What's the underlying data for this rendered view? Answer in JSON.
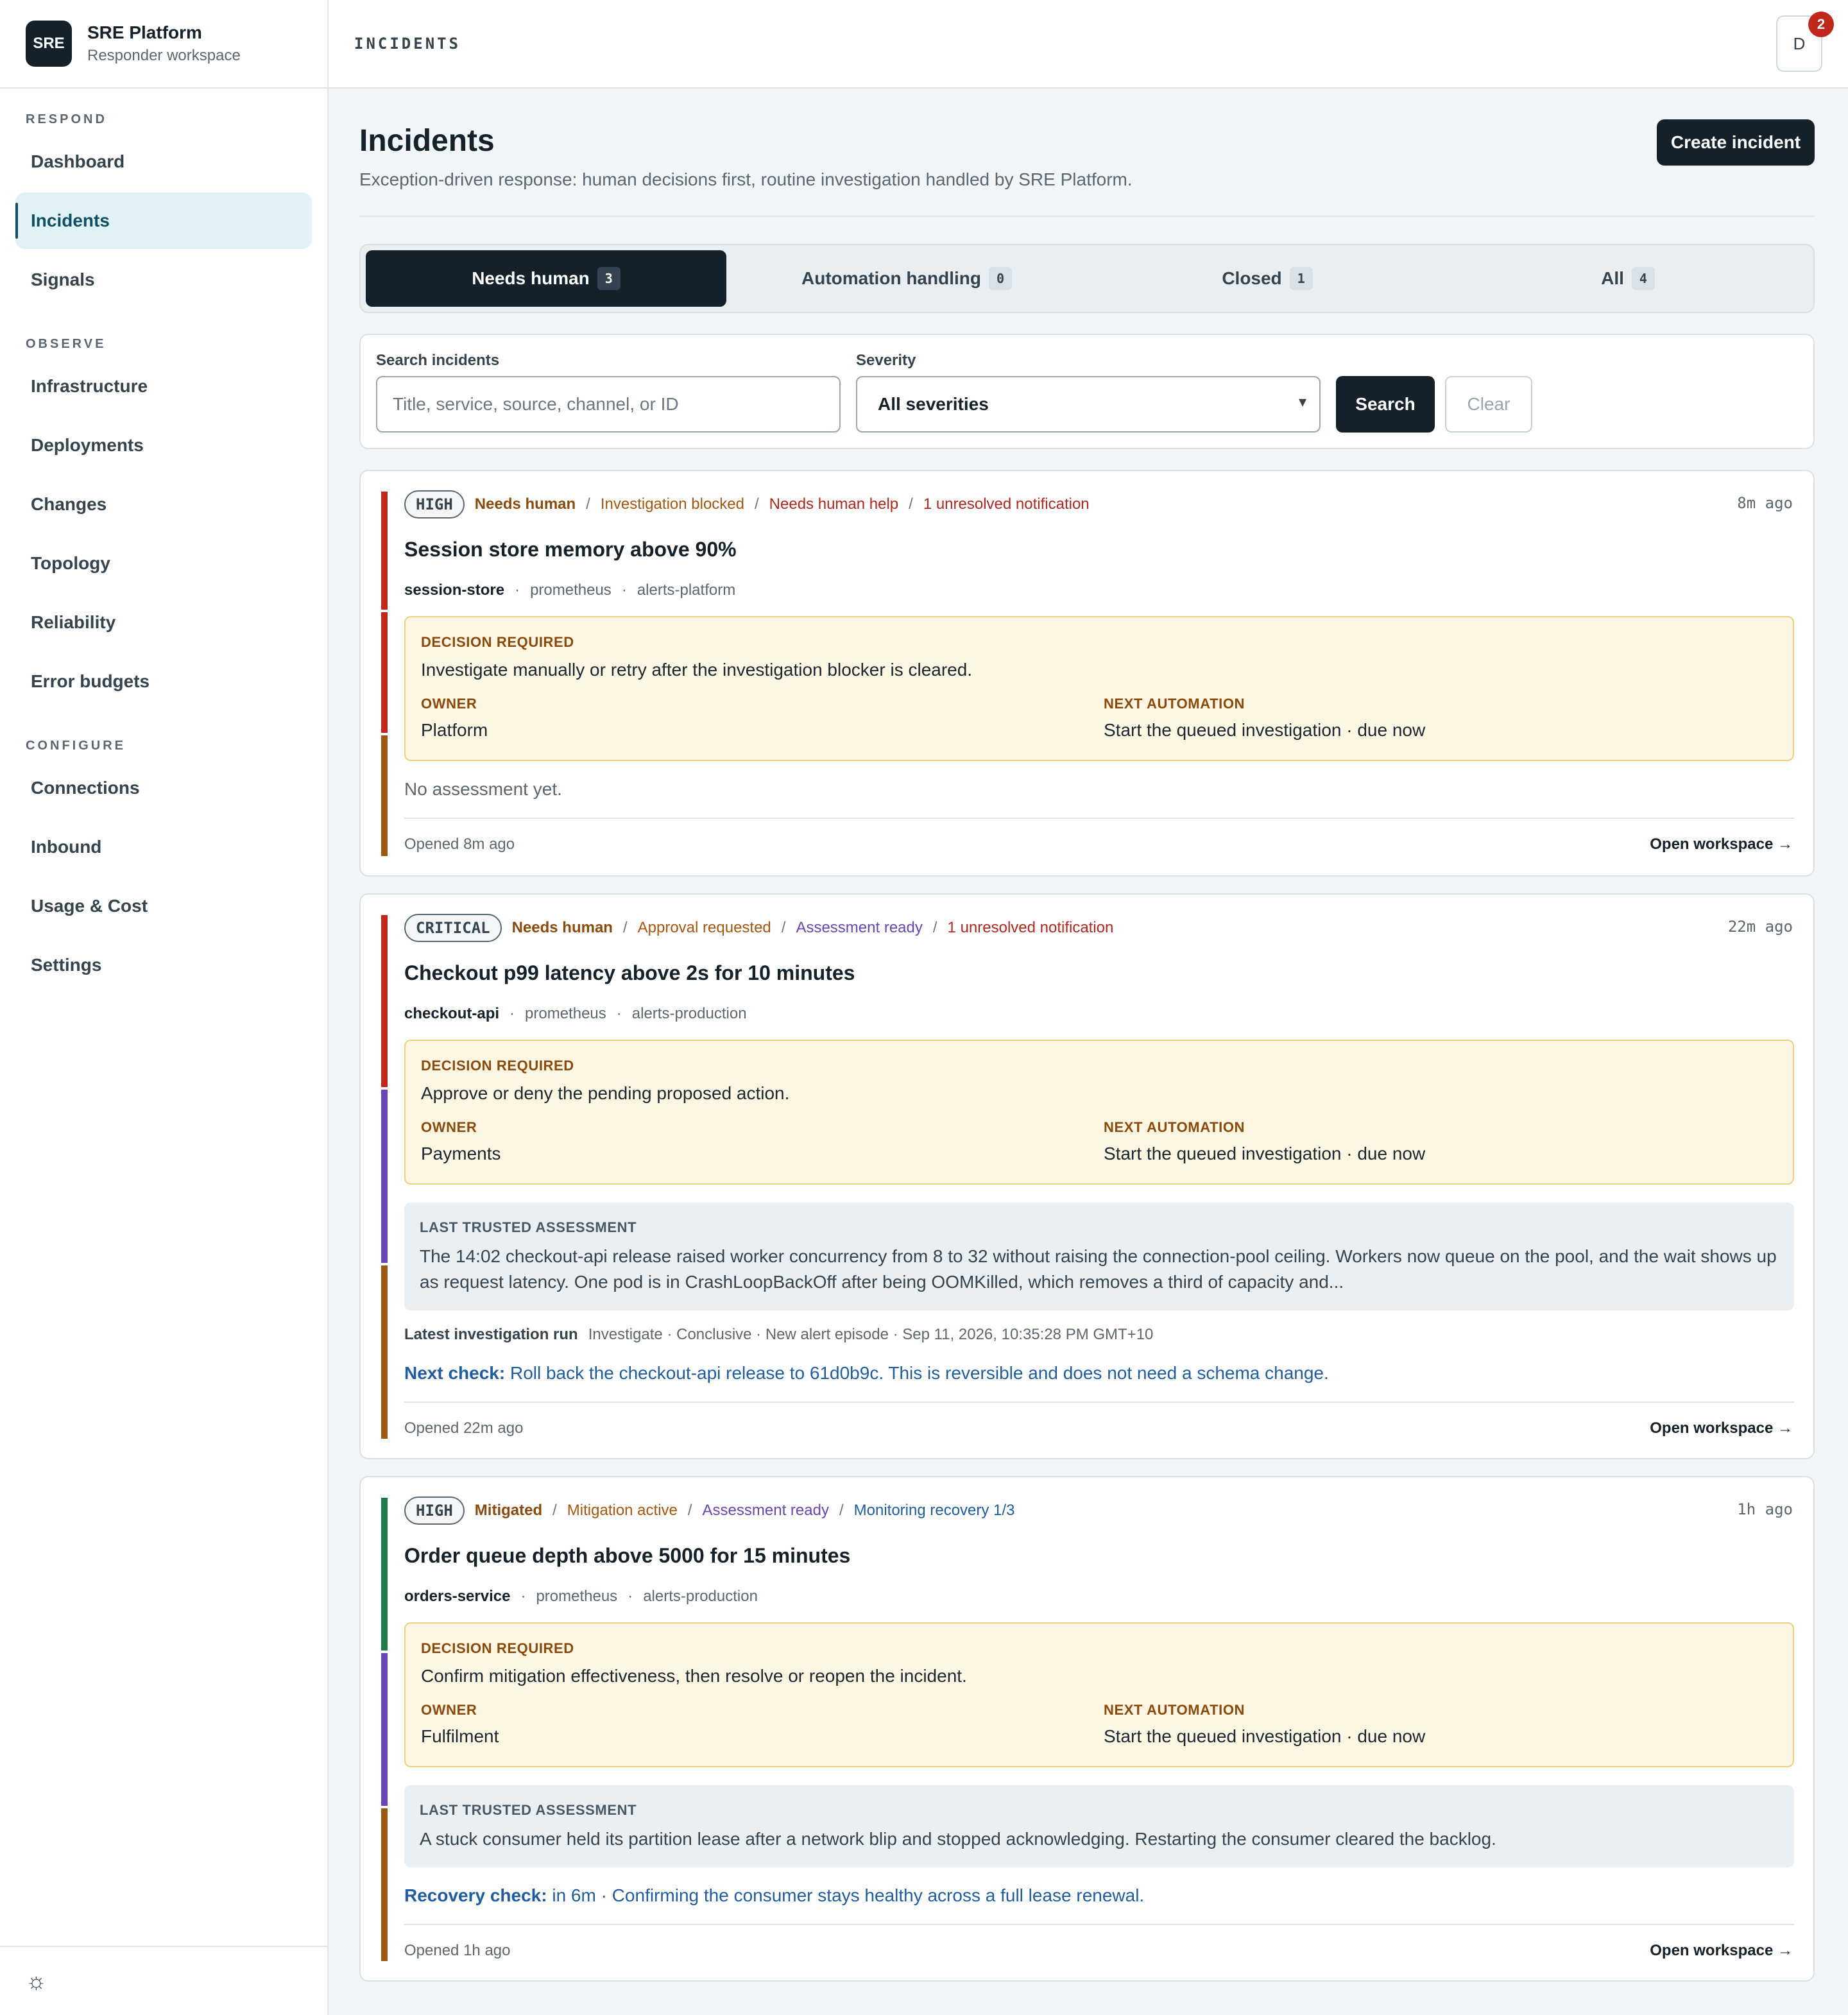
{
  "brand": {
    "logo": "SRE",
    "title": "SRE Platform",
    "subtitle": "Responder workspace"
  },
  "sidebar": {
    "sections": [
      {
        "label": "RESPOND",
        "items": [
          "Dashboard",
          "Incidents",
          "Signals"
        ]
      },
      {
        "label": "OBSERVE",
        "items": [
          "Infrastructure",
          "Deployments",
          "Changes",
          "Topology",
          "Reliability",
          "Error budgets"
        ]
      },
      {
        "label": "CONFIGURE",
        "items": [
          "Connections",
          "Inbound",
          "Usage & Cost",
          "Settings"
        ]
      }
    ],
    "active_item": "Incidents",
    "theme_icon": "sun-icon"
  },
  "topbar": {
    "title": "INCIDENTS",
    "avatar_initial": "D",
    "notification_count": "2"
  },
  "page": {
    "title": "Incidents",
    "subtitle": "Exception-driven response: human decisions first, routine investigation handled by SRE Platform.",
    "create_label": "Create incident"
  },
  "tabs": [
    {
      "label": "Needs human",
      "count": "3",
      "active": true
    },
    {
      "label": "Automation handling",
      "count": "0",
      "active": false
    },
    {
      "label": "Closed",
      "count": "1",
      "active": false
    },
    {
      "label": "All",
      "count": "4",
      "active": false
    }
  ],
  "filters": {
    "search_label": "Search incidents",
    "search_placeholder": "Title, service, source, channel, ID",
    "search_placeholder_full": "Title, service, source, channel, or ID",
    "search_value": "",
    "severity_label": "Severity",
    "severity_value": "All severities",
    "search_button": "Search",
    "clear_button": "Clear"
  },
  "incidents": [
    {
      "severity": "HIGH",
      "state": "Needs human",
      "tags": [
        {
          "text": "Investigation blocked",
          "tone": "orange"
        },
        {
          "text": "Needs human help",
          "tone": "red"
        },
        {
          "text": "1 unresolved notification",
          "tone": "red"
        }
      ],
      "age": "8m ago",
      "title": "Session store memory above 90%",
      "service": "session-store",
      "source": "prometheus",
      "channel": "alerts-platform",
      "decision_label": "DECISION REQUIRED",
      "decision": "Investigate manually or retry after the investigation blocker is cleared.",
      "owner_label": "OWNER",
      "owner": "Platform",
      "next_label": "NEXT AUTOMATION",
      "next_automation": "Start the queued investigation · due now",
      "no_assessment": "No assessment yet.",
      "opened": "Opened 8m ago",
      "workspace_link": "Open workspace →"
    },
    {
      "severity": "CRITICAL",
      "state": "Needs human",
      "tags": [
        {
          "text": "Approval requested",
          "tone": "orange"
        },
        {
          "text": "Assessment ready",
          "tone": "purple"
        },
        {
          "text": "1 unresolved notification",
          "tone": "red"
        }
      ],
      "age": "22m ago",
      "title": "Checkout p99 latency above 2s for 10 minutes",
      "service": "checkout-api",
      "source": "prometheus",
      "channel": "alerts-production",
      "decision_label": "DECISION REQUIRED",
      "decision": "Approve or deny the pending proposed action.",
      "owner_label": "OWNER",
      "owner": "Payments",
      "next_label": "NEXT AUTOMATION",
      "next_automation": "Start the queued investigation · due now",
      "assessment_label": "LAST TRUSTED ASSESSMENT",
      "assessment": "The 14:02 checkout-api release raised worker concurrency from 8 to 32 without raising the connection-pool ceiling. Workers now queue on the pool, and the wait shows up as request latency. One pod is in CrashLoopBackOff after being OOMKilled, which removes a third of capacity and...",
      "run_label": "Latest investigation run",
      "run": "Investigate · Conclusive · New alert episode · Sep 11, 2026, 10:35:28 PM GMT+10",
      "check_label": "Next check:",
      "check": "Roll back the checkout-api release to 61d0b9c. This is reversible and does not need a schema change.",
      "opened": "Opened 22m ago",
      "workspace_link": "Open workspace →"
    },
    {
      "severity": "HIGH",
      "state": "Mitigated",
      "tags": [
        {
          "text": "Mitigation active",
          "tone": "orange"
        },
        {
          "text": "Assessment ready",
          "tone": "purple"
        },
        {
          "text": "Monitoring recovery 1/3",
          "tone": "blue"
        }
      ],
      "age": "1h ago",
      "title": "Order queue depth above 5000 for 15 minutes",
      "service": "orders-service",
      "source": "prometheus",
      "channel": "alerts-production",
      "decision_label": "DECISION REQUIRED",
      "decision": "Confirm mitigation effectiveness, then resolve or reopen the incident.",
      "owner_label": "OWNER",
      "owner": "Fulfilment",
      "next_label": "NEXT AUTOMATION",
      "next_automation": "Start the queued investigation · due now",
      "assessment_label": "LAST TRUSTED ASSESSMENT",
      "assessment": "A stuck consumer held its partition lease after a network blip and stopped acknowledging. Restarting the consumer cleared the backlog.",
      "check_label": "Recovery check:",
      "check": "in 6m · Confirming the consumer stays healthy across a full lease renewal.",
      "opened": "Opened 1h ago",
      "workspace_link": "Open workspace →"
    }
  ],
  "colors": {
    "primary": "#14212b",
    "rail_red": "#c0281e",
    "rail_purple": "#6a45b5",
    "rail_brown": "#9a5a14",
    "rail_green": "#1f7a4a",
    "decision_bg": "#fdf6e3"
  }
}
